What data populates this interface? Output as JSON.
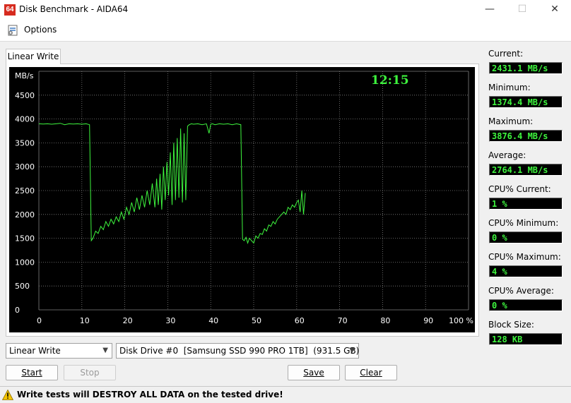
{
  "window": {
    "title": "Disk Benchmark - AIDA64",
    "icon_text": "64"
  },
  "menu": {
    "options_label": "Options"
  },
  "tab": {
    "label": "Linear Write"
  },
  "stats": [
    {
      "label": "Current:",
      "value": "2431.1 MB/s"
    },
    {
      "label": "Minimum:",
      "value": "1374.4 MB/s"
    },
    {
      "label": "Maximum:",
      "value": "3876.4 MB/s"
    },
    {
      "label": "Average:",
      "value": "2764.1 MB/s"
    },
    {
      "label": "CPU% Current:",
      "value": "1 %"
    },
    {
      "label": "CPU% Minimum:",
      "value": "0 %"
    },
    {
      "label": "CPU% Maximum:",
      "value": "4 %"
    },
    {
      "label": "CPU% Average:",
      "value": "0 %"
    },
    {
      "label": "Block Size:",
      "value": "128 KB"
    }
  ],
  "controls": {
    "test_select": "Linear Write",
    "drive_select": "Disk Drive #0  [Samsung SSD 990 PRO 1TB]  (931.5 GB)",
    "start": "Start",
    "stop": "Stop",
    "save": "Save",
    "clear": "Clear"
  },
  "warning": "Write tests will DESTROY ALL DATA on the tested drive!",
  "colors": {
    "line": "#3ef53e",
    "grid": "#808080",
    "clock": "#3ef53e",
    "bg": "#000000"
  },
  "chart_data": {
    "type": "line",
    "ylabel": "MB/s",
    "time": "12:15",
    "ylim": [
      0,
      5000
    ],
    "xlim": [
      0,
      100
    ],
    "y_ticks": [
      "0",
      "500",
      "1000",
      "1500",
      "2000",
      "2500",
      "3000",
      "3500",
      "4000",
      "4500"
    ],
    "x_ticks": [
      "0",
      "10",
      "20",
      "30",
      "40",
      "50",
      "60",
      "70",
      "80",
      "90",
      "100 %"
    ],
    "series": [
      {
        "x": [
          0,
          1,
          2,
          3,
          4,
          5,
          6,
          7,
          8,
          9,
          10,
          11,
          11.8,
          12.2,
          12.6,
          13.2,
          13.8,
          14.4,
          15,
          15.6,
          16.2,
          16.8,
          17.4,
          18,
          18.6,
          19.2,
          19.8,
          20.4,
          21,
          21.6,
          22.2,
          22.8,
          23.4,
          24,
          24.6,
          25.2,
          25.8,
          26.4,
          27,
          27.4,
          27.8,
          28.2,
          28.6,
          29,
          29.4,
          29.8,
          30.2,
          30.6,
          31,
          31.4,
          31.8,
          32.2,
          32.6,
          33,
          33.4,
          33.8,
          34.2,
          34.6,
          35,
          35.5,
          36,
          37,
          38,
          39,
          39.6,
          40,
          40.4,
          41,
          42,
          43,
          44,
          45,
          46,
          47,
          47.4,
          47.8,
          48.2,
          48.6,
          49,
          49.5,
          50,
          50.5,
          51,
          51.5,
          52,
          52.5,
          53,
          53.5,
          54,
          54.5,
          55,
          55.5,
          56,
          56.5,
          57,
          57.5,
          58,
          58.5,
          59,
          59.5,
          60,
          60.4,
          60.8,
          61.2,
          61.6,
          62
        ],
        "y": [
          3900,
          3895,
          3900,
          3890,
          3900,
          3910,
          3880,
          3900,
          3895,
          3900,
          3890,
          3900,
          3880,
          1450,
          1500,
          1650,
          1600,
          1750,
          1680,
          1850,
          1750,
          1900,
          1800,
          1950,
          1850,
          2050,
          1900,
          2150,
          2000,
          2250,
          2050,
          2350,
          2100,
          2400,
          2150,
          2500,
          2200,
          2650,
          2150,
          2750,
          2200,
          2850,
          2100,
          3000,
          2300,
          3100,
          2400,
          3300,
          2200,
          3500,
          2300,
          3600,
          2350,
          3800,
          2250,
          3700,
          2300,
          3850,
          3880,
          3900,
          3890,
          3900,
          3880,
          3900,
          3700,
          3890,
          3900,
          3880,
          3900,
          3890,
          3900,
          3880,
          3900,
          3880,
          1480,
          1450,
          1520,
          1400,
          1500,
          1450,
          1400,
          1550,
          1500,
          1600,
          1580,
          1700,
          1650,
          1780,
          1750,
          1850,
          1800,
          1900,
          1950,
          2000,
          2050,
          2000,
          2150,
          2100,
          2200,
          2150,
          2250,
          2300,
          2050,
          2500,
          2000,
          2450
        ]
      }
    ]
  }
}
